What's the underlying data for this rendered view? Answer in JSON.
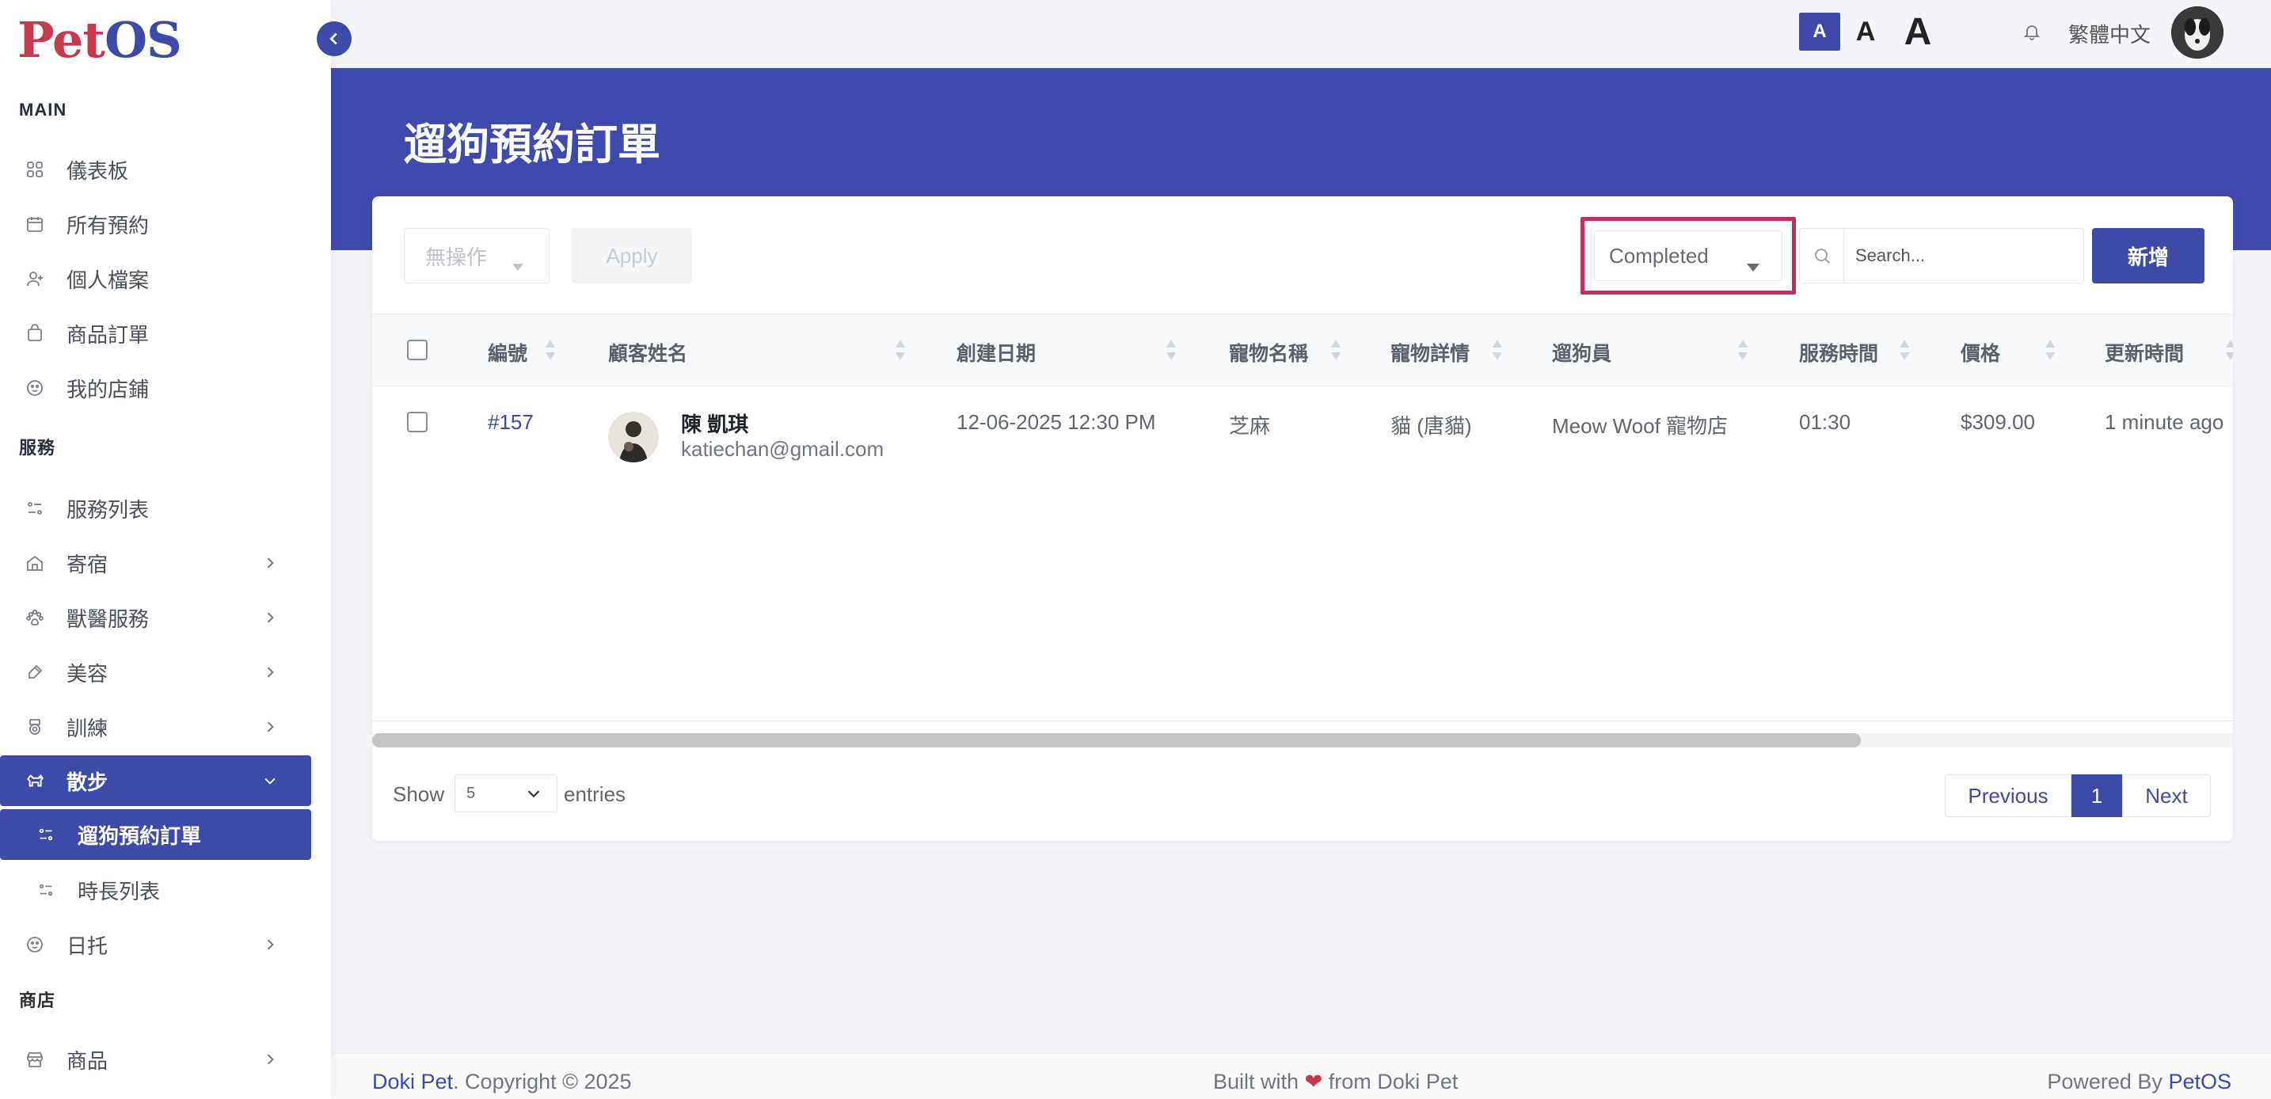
{
  "brand": {
    "logo_part1": "Pet",
    "logo_part2": "OS"
  },
  "sidebar": {
    "section_main": "MAIN",
    "section_services": "服務",
    "section_shop": "商店",
    "main_items": [
      {
        "label": "儀表板",
        "icon": "grid-icon"
      },
      {
        "label": "所有預約",
        "icon": "calendar-icon"
      },
      {
        "label": "個人檔案",
        "icon": "user-icon"
      },
      {
        "label": "商品訂單",
        "icon": "bag-icon"
      },
      {
        "label": "我的店鋪",
        "icon": "paw-badge-icon"
      }
    ],
    "service_items": [
      {
        "label": "服務列表",
        "icon": "list-icon"
      },
      {
        "label": "寄宿",
        "icon": "home-icon"
      },
      {
        "label": "獸醫服務",
        "icon": "paw-icon"
      },
      {
        "label": "美容",
        "icon": "brush-icon"
      },
      {
        "label": "訓練",
        "icon": "medal-icon"
      },
      {
        "label": "散步",
        "icon": "dog-icon"
      }
    ],
    "walk_sub_items": [
      {
        "label": "遛狗預約訂單"
      },
      {
        "label": "時長列表"
      }
    ],
    "daycare_item": {
      "label": "日托"
    },
    "shop_items": [
      {
        "label": "商品"
      }
    ]
  },
  "topbar": {
    "font_small": "A",
    "font_medium": "A",
    "font_large": "A",
    "language": "繁體中文"
  },
  "page": {
    "title": "遛狗預約訂單"
  },
  "toolbar": {
    "bulk_action": "無操作",
    "apply_label": "Apply",
    "status_filter": "Completed",
    "search_placeholder": "Search...",
    "add_label": "新增"
  },
  "table": {
    "headers": [
      "編號",
      "顧客姓名",
      "創建日期",
      "寵物名稱",
      "寵物詳情",
      "遛狗員",
      "服務時間",
      "價格",
      "更新時間"
    ],
    "rows": [
      {
        "id": "#157",
        "customer_name": "陳 凱琪",
        "customer_email": "katiechan@gmail.com",
        "created": "12-06-2025 12:30 PM",
        "pet_name": "芝麻",
        "pet_details": "貓 (唐貓)",
        "walker": "Meow Woof 寵物店",
        "duration": "01:30",
        "price": "$309.00",
        "updated": "1 minute ago"
      }
    ]
  },
  "pagination": {
    "show_label": "Show",
    "entries_value": "5",
    "entries_label": "entries",
    "prev_label": "Previous",
    "current_page": "1",
    "next_label": "Next",
    "scroll_position": 0.8
  },
  "footer": {
    "brand": "Doki Pet",
    "copyright": ". Copyright © 2025",
    "built_with": "Built with",
    "from": "from Doki Pet",
    "powered_by": "Powered By",
    "powered_brand": "PetOS"
  },
  "colors": {
    "primary": "#3d4aa8",
    "header_band": "#404aad",
    "highlight": "#c0305a",
    "logo_red": "#c8374c"
  }
}
